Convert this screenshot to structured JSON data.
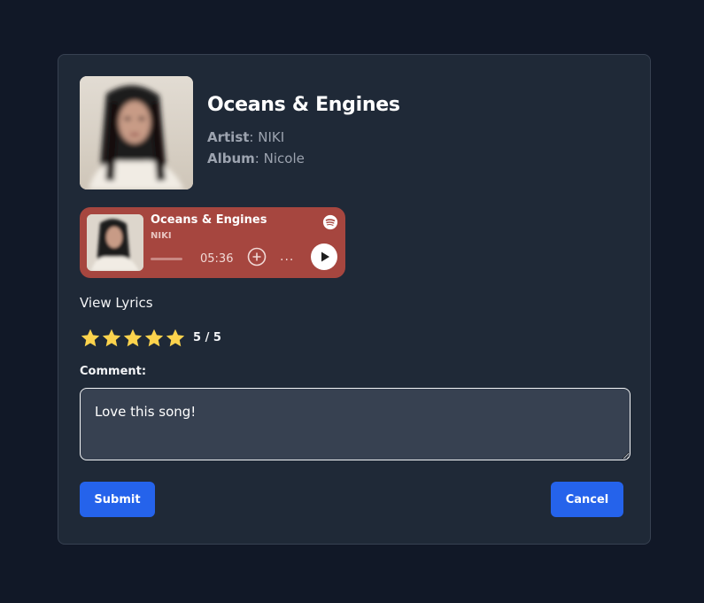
{
  "song": {
    "title": "Oceans & Engines",
    "artist_label": "Artist",
    "artist": "NIKI",
    "album_label": "Album",
    "album": "Nicole"
  },
  "player": {
    "title": "Oceans & Engines",
    "artist": "NIKI",
    "duration": "05:36",
    "more": "···",
    "background": "#a6463f",
    "icons": [
      "spotify-icon",
      "add-circle-icon",
      "more-icon",
      "play-icon"
    ]
  },
  "lyrics_link": "View Lyrics",
  "rating": {
    "value": 5,
    "max": 5,
    "text": "5 / 5",
    "star_color": "#fcd34d"
  },
  "comment": {
    "label": "Comment:",
    "value": "Love this song!"
  },
  "buttons": {
    "submit": "Submit",
    "cancel": "Cancel",
    "color": "#2563eb"
  }
}
